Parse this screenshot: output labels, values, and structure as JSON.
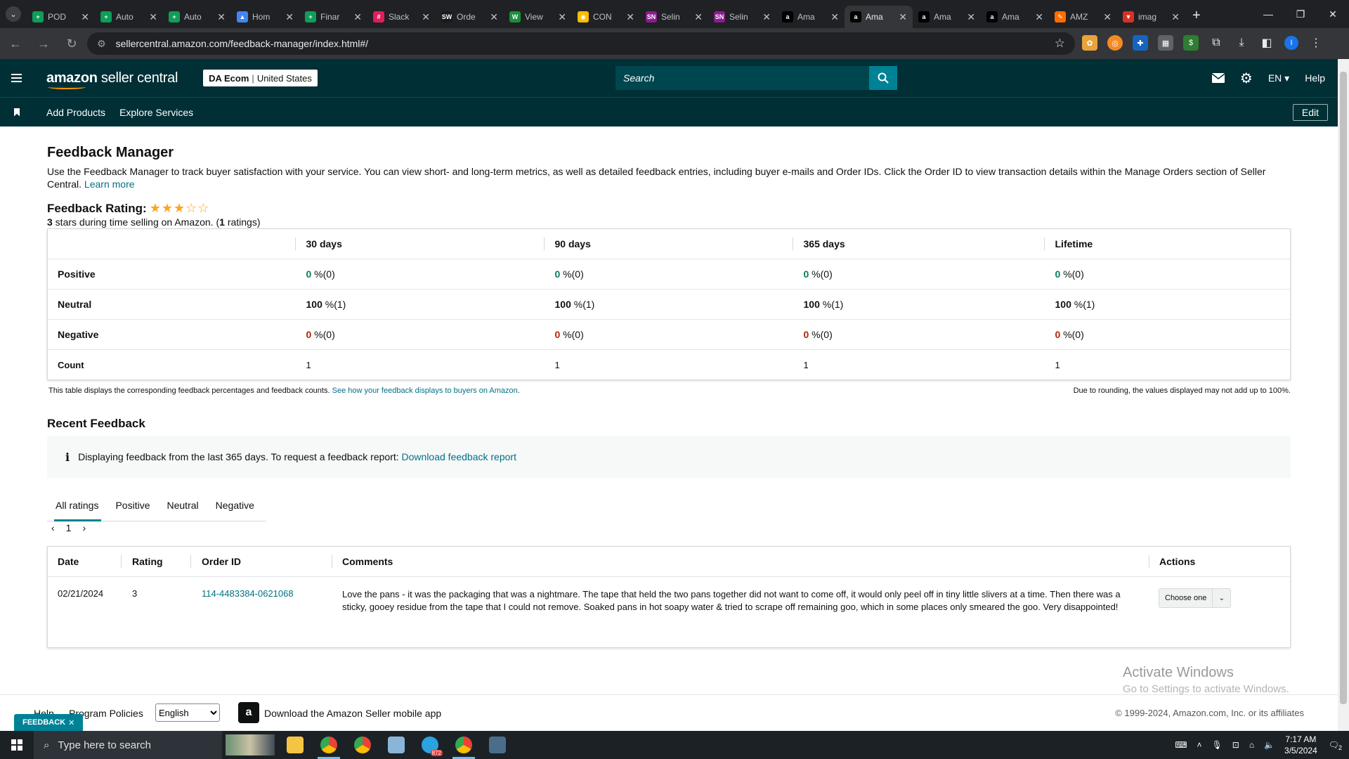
{
  "browser": {
    "tabs": [
      {
        "title": "POD",
        "color": "#0f9d58",
        "glyph": "+"
      },
      {
        "title": "Auto",
        "color": "#0f9d58",
        "glyph": "+"
      },
      {
        "title": "Auto",
        "color": "#0f9d58",
        "glyph": "+"
      },
      {
        "title": "Hom",
        "color": "#4285f4",
        "glyph": "▲"
      },
      {
        "title": "Finar",
        "color": "#0f9d58",
        "glyph": "+"
      },
      {
        "title": "Slack",
        "color": "#e01e5a",
        "glyph": "#"
      },
      {
        "title": "Orde",
        "color": "#1a1a1a",
        "glyph": "SW"
      },
      {
        "title": "View",
        "color": "#1a8f3c",
        "glyph": "W"
      },
      {
        "title": "CON",
        "color": "#fbbc04",
        "glyph": "◉"
      },
      {
        "title": "Selin",
        "color": "#8e1b8e",
        "glyph": "SN"
      },
      {
        "title": "Selin",
        "color": "#8e1b8e",
        "glyph": "SN"
      },
      {
        "title": "Ama",
        "color": "#000000",
        "glyph": "a"
      },
      {
        "title": "Ama",
        "color": "#000000",
        "glyph": "a"
      },
      {
        "title": "Ama",
        "color": "#000000",
        "glyph": "a"
      },
      {
        "title": "Ama",
        "color": "#000000",
        "glyph": "a"
      },
      {
        "title": "AMZ",
        "color": "#ff6d00",
        "glyph": "✎"
      },
      {
        "title": "imag",
        "color": "#d93025",
        "glyph": "▼"
      }
    ],
    "url": "sellercentral.amazon.com/feedback-manager/index.html#/"
  },
  "header": {
    "logo_brand": "amazon",
    "logo_rest": " seller central",
    "store_name": "DA Ecom",
    "store_region": "United States",
    "search_placeholder": "Search",
    "language": "EN ▾",
    "help": "Help"
  },
  "subnav": {
    "items": [
      "Add Products",
      "Explore Services"
    ],
    "edit": "Edit"
  },
  "page": {
    "title": "Feedback Manager",
    "intro": "Use the Feedback Manager to track buyer satisfaction with your service. You can view short- and long-term metrics, as well as detailed feedback entries, including buyer e-mails and Order IDs. Click the Order ID to view transaction details within the Manage Orders section of Seller Central.",
    "learn_more": "Learn more",
    "rating_label": "Feedback Rating:",
    "rating_stars": 3,
    "rating_max": 5,
    "rating_stars_number": "3",
    "rating_sub_mid": " stars during time selling on Amazon. (",
    "rating_count": "1",
    "rating_sub_end": " ratings)"
  },
  "metrics": {
    "columns": [
      "30 days",
      "90 days",
      "365 days",
      "Lifetime"
    ],
    "rows": [
      {
        "label": "Positive",
        "cls": "g",
        "values": [
          {
            "n": "0",
            "s": " %(0)"
          },
          {
            "n": "0",
            "s": " %(0)"
          },
          {
            "n": "0",
            "s": " %(0)"
          },
          {
            "n": "0",
            "s": " %(0)"
          }
        ]
      },
      {
        "label": "Neutral",
        "cls": "n",
        "values": [
          {
            "n": "100",
            "s": " %(1)"
          },
          {
            "n": "100",
            "s": " %(1)"
          },
          {
            "n": "100",
            "s": " %(1)"
          },
          {
            "n": "100",
            "s": " %(1)"
          }
        ]
      },
      {
        "label": "Negative",
        "cls": "r",
        "values": [
          {
            "n": "0",
            "s": " %(0)"
          },
          {
            "n": "0",
            "s": " %(0)"
          },
          {
            "n": "0",
            "s": " %(0)"
          },
          {
            "n": "0",
            "s": " %(0)"
          }
        ]
      }
    ],
    "count_label": "Count",
    "counts": [
      "1",
      "1",
      "1",
      "1"
    ],
    "note": "This table displays the corresponding feedback percentages and feedback counts.",
    "note_link": "See how your feedback displays to buyers on Amazon",
    "rounding_note": "Due to rounding, the values displayed may not add up to 100%."
  },
  "recent": {
    "title": "Recent Feedback",
    "info_text": "Displaying feedback from the last 365 days. To request a feedback report:",
    "info_link": "Download feedback report",
    "tabs": [
      "All ratings",
      "Positive",
      "Neutral",
      "Negative"
    ],
    "page": "1",
    "headers": {
      "date": "Date",
      "rating": "Rating",
      "order": "Order ID",
      "comments": "Comments",
      "actions": "Actions"
    },
    "rows": [
      {
        "date": "02/21/2024",
        "rating": "3",
        "order_id": "114-4483384-0621068",
        "comment": "Love the pans - it was the packaging that was a nightmare. The tape that held the two pans together did not want to come off, it would only peel off in tiny little slivers at a time. Then there was a sticky, gooey residue from the tape that I could not remove. Soaked pans in hot soapy water & tried to scrape off remaining goo, which in some places only smeared the goo. Very disappointed!",
        "action": "Choose one"
      }
    ]
  },
  "watermark": {
    "line1": "Activate Windows",
    "line2": "Go to Settings to activate Windows."
  },
  "footer": {
    "help": "Help",
    "policies": "Program Policies",
    "language": "English",
    "app_text": "Download the Amazon Seller mobile app",
    "copyright": "© 1999-2024, Amazon.com, Inc. or its affiliates",
    "feedback_tab": "FEEDBACK"
  },
  "taskbar": {
    "search_placeholder": "Type here to search",
    "time": "7:17 AM",
    "date": "3/5/2024",
    "telegram_badge": "872",
    "notif_count": "2"
  }
}
